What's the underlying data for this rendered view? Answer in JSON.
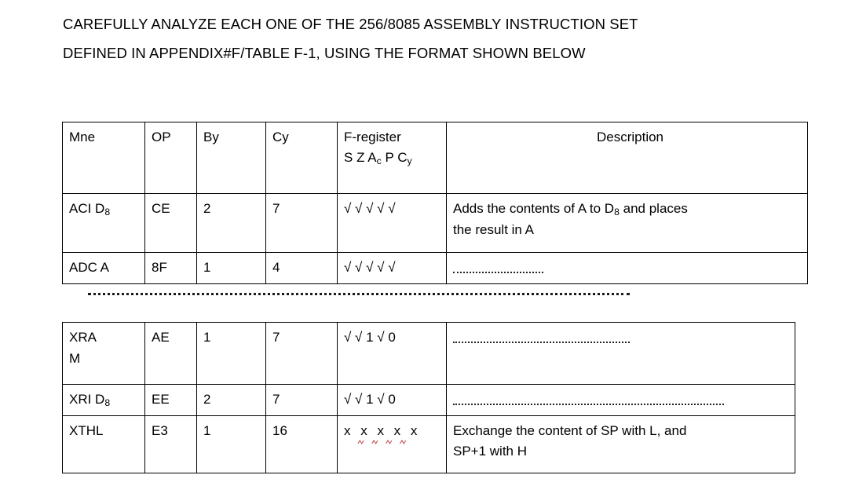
{
  "heading": {
    "line1": "CAREFULLY ANALYZE EACH ONE OF THE 256/8085 ASSEMBLY INSTRUCTION SET",
    "line2": "DEFINED IN APPENDIX#F/TABLE F-1, USING THE FORMAT SHOWN BELOW"
  },
  "colors": {
    "text": "#000000",
    "border": "#000000",
    "spellcheck_underline": "#c0504d",
    "background": "#ffffff"
  },
  "table1": {
    "headers": {
      "mnemonic": "Mne",
      "opcode": "OP",
      "bytes": "By",
      "cycles": "Cy",
      "flags_title": "F-register",
      "flags_legend_sign": "S",
      "flags_legend_zero": "Z",
      "flags_legend_aux": "A",
      "flags_legend_aux_sub": "c",
      "flags_legend_parity": "P",
      "flags_legend_carry": "C",
      "flags_legend_carry_sub": "y",
      "description": "Description"
    },
    "rows": [
      {
        "mnemonic": "ACI D",
        "mnemonic_sub": "8",
        "opcode": "CE",
        "bytes": "2",
        "cycles": "7",
        "flags": "√ √ √  √ √",
        "description_line1": "Adds the contents of A to D",
        "description_line1_sub": "8",
        "description_line1_tail": " and places",
        "description_line2": "the result in A",
        "description_is_dotted": false
      },
      {
        "mnemonic": "ADC A",
        "mnemonic_sub": "",
        "opcode": "8F",
        "bytes": "1",
        "cycles": "4",
        "flags": "√ √ √  √ √",
        "description_line1": "",
        "description_line1_sub": "",
        "description_line1_tail": "",
        "description_line2": "",
        "description_is_dotted": true
      }
    ]
  },
  "separator": {
    "style": "dotted-rule"
  },
  "table2": {
    "rows": [
      {
        "mnemonic_line1": "XRA",
        "mnemonic_line2": "M",
        "mnemonic_sub": "",
        "opcode": "AE",
        "bytes": "1",
        "cycles": "7",
        "flags": "√ √ 1 √ 0",
        "description_is_dotted": true,
        "description_dots_length": "medium-short"
      },
      {
        "mnemonic_line1": "XRI D",
        "mnemonic_line2": "",
        "mnemonic_sub": "8",
        "opcode": "EE",
        "bytes": "2",
        "cycles": "7",
        "flags": "√ √  1 √ 0",
        "description_is_dotted": true,
        "description_dots_length": "medium"
      },
      {
        "mnemonic_line1": "XTHL",
        "mnemonic_line2": "",
        "mnemonic_sub": "",
        "opcode": "E3",
        "bytes": "1",
        "cycles": "16",
        "flags": "x x x x x",
        "flags_has_spellcheck_squiggle": true,
        "description_line1": "Exchange the content of SP with L, and",
        "description_line2": "SP+1 with H",
        "description_is_dotted": false
      }
    ]
  }
}
